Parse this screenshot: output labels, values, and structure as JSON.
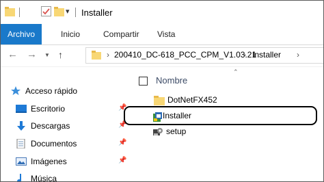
{
  "window": {
    "title": "Installer"
  },
  "ribbon": {
    "tabs": [
      "Archivo",
      "Inicio",
      "Compartir",
      "Vista"
    ]
  },
  "address": {
    "crumbs": [
      "200410_DC-618_PCC_CPM_V1.03.21",
      "Installer"
    ]
  },
  "sidebar": {
    "items": [
      {
        "label": "Acceso rápido",
        "icon": "star-icon"
      },
      {
        "label": "Escritorio",
        "icon": "desktop-icon"
      },
      {
        "label": "Descargas",
        "icon": "download-icon"
      },
      {
        "label": "Documentos",
        "icon": "document-icon"
      },
      {
        "label": "Imágenes",
        "icon": "image-icon"
      },
      {
        "label": "Música",
        "icon": "music-icon"
      }
    ]
  },
  "content": {
    "column_header": "Nombre",
    "files": [
      {
        "name": "DotNetFX452",
        "icon": "folder-icon"
      },
      {
        "name": "Installer",
        "icon": "installer-icon"
      },
      {
        "name": "setup",
        "icon": "setup-icon"
      }
    ]
  },
  "colors": {
    "accent": "#1979ca",
    "folder": "#f8d775"
  }
}
